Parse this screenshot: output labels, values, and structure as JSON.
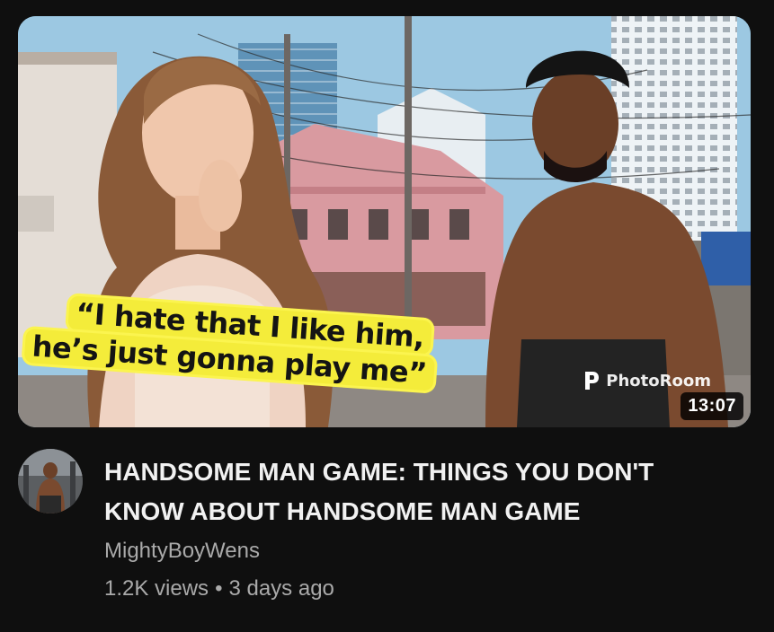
{
  "video": {
    "title": "HANDSOME MAN GAME: THINGS YOU DON'T KNOW ABOUT HANDSOME MAN GAME",
    "duration": "13:07",
    "thumbnail": {
      "caption_line1": "“I hate that I like him,",
      "caption_line2": "he’s just gonna play me”",
      "watermark": "PhotoRoom"
    }
  },
  "channel": {
    "name": "MightyBoyWens"
  },
  "stats": {
    "views": "1.2K views",
    "separator": "•",
    "age": "3 days ago"
  },
  "colors": {
    "background": "#0f0f0f",
    "title": "#f1f1f1",
    "secondary_text": "#aaaaaa",
    "caption_highlight": "#f4ec3a"
  }
}
